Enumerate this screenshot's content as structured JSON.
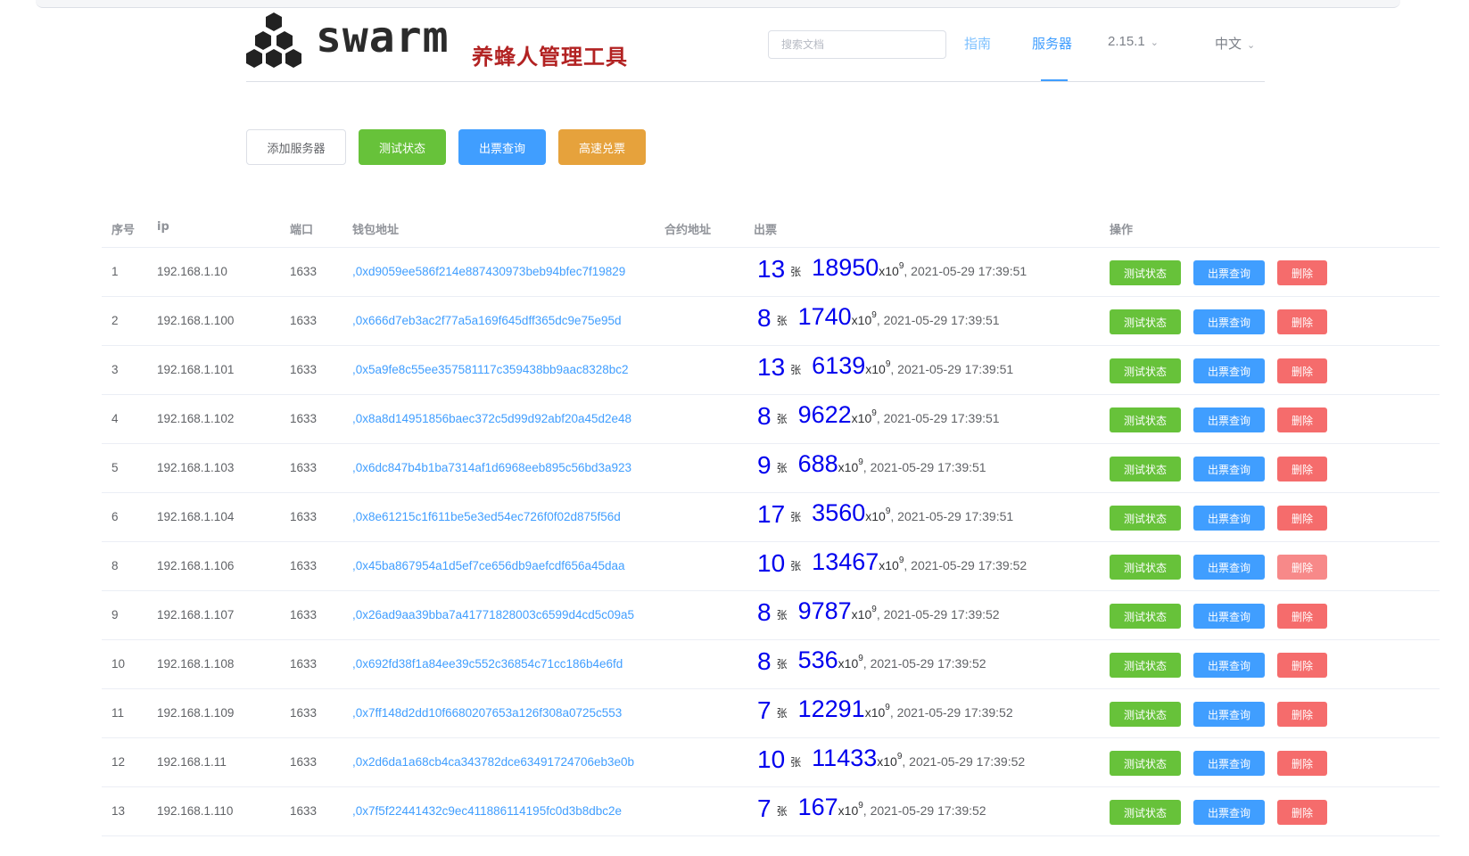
{
  "header": {
    "logo_text": "swarm",
    "logo_subtitle": "养蜂人管理工具",
    "search_placeholder": "搜索文档",
    "nav": {
      "guide": "指南",
      "servers": "服务器",
      "version": "2.15.1",
      "language": "中文"
    }
  },
  "toolbar": {
    "add_server": "添加服务器",
    "test_status": "测试状态",
    "ticket_query": "出票查询",
    "fast_redeem": "高速兑票"
  },
  "table": {
    "headers": {
      "index": "序号",
      "ip": "ip",
      "port": "端口",
      "wallet": "钱包地址",
      "contract": "合约地址",
      "tickets": "出票",
      "actions": "操作"
    },
    "ticket_unit": "张",
    "multiplier": "x10",
    "exponent": "9",
    "actions": {
      "test": "测试状态",
      "query": "出票查询",
      "delete": "删除"
    },
    "rows": [
      {
        "index": "1",
        "ip": "192.168.1.10",
        "port": "1633",
        "wallet": ",0xd9059ee586f214e887430973beb94bfec7f19829",
        "count": "13",
        "amount": "18950",
        "time": ", 2021-05-29 17:39:51"
      },
      {
        "index": "2",
        "ip": "192.168.1.100",
        "port": "1633",
        "wallet": ",0x666d7eb3ac2f77a5a169f645dff365dc9e75e95d",
        "count": "8",
        "amount": "1740",
        "time": ", 2021-05-29 17:39:51"
      },
      {
        "index": "3",
        "ip": "192.168.1.101",
        "port": "1633",
        "wallet": ",0x5a9fe8c55ee357581117c359438bb9aac8328bc2",
        "count": "13",
        "amount": "6139",
        "time": ", 2021-05-29 17:39:51"
      },
      {
        "index": "4",
        "ip": "192.168.1.102",
        "port": "1633",
        "wallet": ",0x8a8d14951856baec372c5d99d92abf20a45d2e48",
        "count": "8",
        "amount": "9622",
        "time": ", 2021-05-29 17:39:51"
      },
      {
        "index": "5",
        "ip": "192.168.1.103",
        "port": "1633",
        "wallet": ",0x6dc847b4b1ba7314af1d6968eeb895c56bd3a923",
        "count": "9",
        "amount": "688",
        "time": ", 2021-05-29 17:39:51"
      },
      {
        "index": "6",
        "ip": "192.168.1.104",
        "port": "1633",
        "wallet": ",0x8e61215c1f611be5e3ed54ec726f0f02d875f56d",
        "count": "17",
        "amount": "3560",
        "time": ", 2021-05-29 17:39:51"
      },
      {
        "index": "8",
        "ip": "192.168.1.106",
        "port": "1633",
        "wallet": ",0x45ba867954a1d5ef7ce656db9aefcdf656a45daa",
        "count": "10",
        "amount": "13467",
        "time": ", 2021-05-29 17:39:52"
      },
      {
        "index": "9",
        "ip": "192.168.1.107",
        "port": "1633",
        "wallet": ",0x26ad9aa39bba7a41771828003c6599d4cd5c09a5",
        "count": "8",
        "amount": "9787",
        "time": ", 2021-05-29 17:39:52"
      },
      {
        "index": "10",
        "ip": "192.168.1.108",
        "port": "1633",
        "wallet": ",0x692fd38f1a84ee39c552c36854c71cc186b4e6fd",
        "count": "8",
        "amount": "536",
        "time": ", 2021-05-29 17:39:52"
      },
      {
        "index": "11",
        "ip": "192.168.1.109",
        "port": "1633",
        "wallet": ",0x7ff148d2dd10f6680207653a126f308a0725c553",
        "count": "7",
        "amount": "12291",
        "time": ", 2021-05-29 17:39:52"
      },
      {
        "index": "12",
        "ip": "192.168.1.11",
        "port": "1633",
        "wallet": ",0x2d6da1a68cb4ca343782dce63491724706eb3e0b",
        "count": "10",
        "amount": "11433",
        "time": ", 2021-05-29 17:39:52"
      },
      {
        "index": "13",
        "ip": "192.168.1.110",
        "port": "1633",
        "wallet": ",0x7f5f22441432c9ec411886114195fc0d3b8dbc2e",
        "count": "7",
        "amount": "167",
        "time": ", 2021-05-29 17:39:52"
      }
    ]
  },
  "colors": {
    "primary": "#409eff",
    "success": "#67c23a",
    "warning": "#e6a23c",
    "danger": "#f56c6c",
    "ticket_value": "#0000ee",
    "subtitle": "#b22222"
  }
}
